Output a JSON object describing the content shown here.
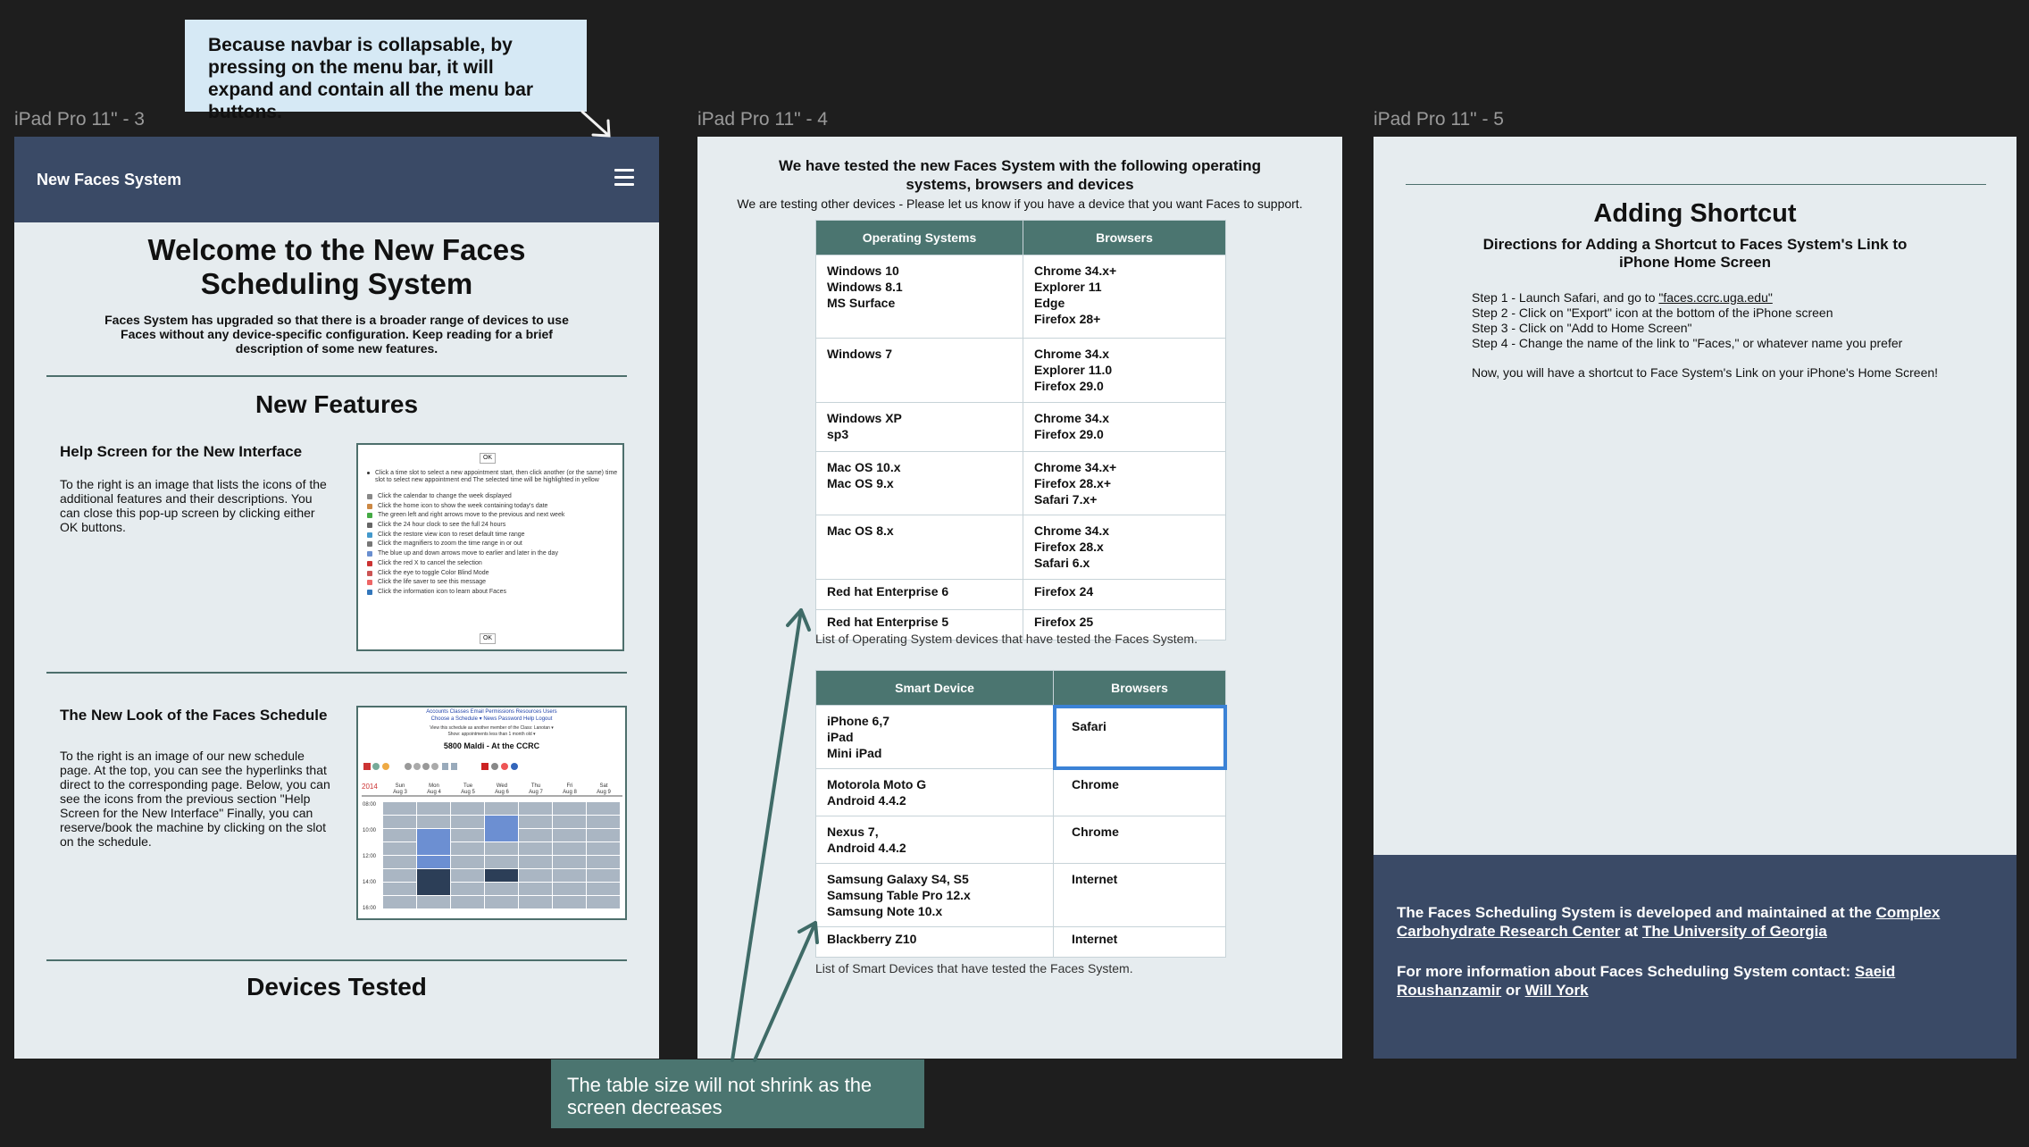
{
  "frames": {
    "f3": {
      "label": "iPad Pro 11\" - 3"
    },
    "f4": {
      "label": "iPad Pro 11\" - 4"
    },
    "f5": {
      "label": "iPad Pro 11\" - 5"
    }
  },
  "annotations": {
    "navbar_note": "Because navbar is collapsable, by pressing on the menu bar, it will expand and contain all the menu bar buttons.",
    "table_note": "The table size will not shrink as the screen decreases"
  },
  "page3": {
    "brand": "New Faces System",
    "welcome_title": "Welcome to the New Faces Scheduling System",
    "intro": "Faces System has upgraded so that there is a broader range of devices to use Faces without any device-specific configuration. Keep reading for a brief description of some new features.",
    "new_features": "New Features",
    "help_title": "Help Screen for the New Interface",
    "help_text": "To the right is an image that lists the icons of the additional features and their descriptions. You can close this pop-up screen by clicking either OK buttons.",
    "help_img": {
      "ok": "OK",
      "lines": [
        "Click a time slot to select a new appointment start, then click another (or the same) time slot to select new appointment end The selected time will be highlighted in yellow",
        "Click the calendar to change the week displayed",
        "Click the home icon to show the week containing today's date",
        "The green left and right arrows move to the previous and next week",
        "Click the 24 hour clock to see the full 24 hours",
        "Click the restore view icon to reset default time range",
        "Click the magnifiers to zoom the time range in or out",
        "The blue up and down arrows move to earlier and later in the day",
        "Click the red X to cancel the selection",
        "Click the eye to toggle Color Blind Mode",
        "Click the life saver to see this message",
        "Click the information icon to learn about Faces"
      ]
    },
    "look_title": "The New Look of the Faces Schedule",
    "look_text": "To the right is an image of our new schedule page. At the top, you can see the hyperlinks that direct to the corresponding page. Below, you can see the icons from the previous section \"Help Screen for the New Interface\" Finally, you can reserve/book the machine by clicking on the slot on the schedule.",
    "sched_img": {
      "links": "Accounts  Classes  Email  Permissions  Resources  Users",
      "links2": "Choose a Schedule ▾   News   Password Help   Logout",
      "view_for": "View this schedule as another member of the Class: Lanotan ▾",
      "show": "Show: appointments less than 1 month old ▾",
      "machine": "5800 Maldi - At the CCRC",
      "year": "2014",
      "days": [
        "Sun",
        "Mon",
        "Tue",
        "Wed",
        "Thu",
        "Fri",
        "Sat"
      ],
      "dates": [
        "Aug 3",
        "Aug 4",
        "Aug 5",
        "Aug 6",
        "Aug 7",
        "Aug 8",
        "Aug 9"
      ],
      "times": [
        "08:00",
        "10:00",
        "12:00",
        "14:00",
        "16:00"
      ]
    },
    "devices_tested": "Devices Tested"
  },
  "page4": {
    "title": "We have tested the new Faces System with the following operating systems, browsers and devices",
    "subtitle": "We are testing other devices - Please let us know if you have a device that you want Faces to support.",
    "os_table": {
      "headers": [
        "Operating Systems",
        "Browsers"
      ],
      "rows": [
        {
          "os": [
            "Windows 10",
            "Windows 8.1",
            "MS Surface"
          ],
          "browsers": [
            "Chrome 34.x+",
            "Explorer 11",
            "Edge",
            "Firefox 28+"
          ]
        },
        {
          "os": [
            "Windows 7"
          ],
          "browsers": [
            "Chrome 34.x",
            "Explorer 11.0",
            "Firefox 29.0"
          ]
        },
        {
          "os": [
            "Windows XP",
            "sp3"
          ],
          "browsers": [
            "Chrome 34.x",
            "Firefox 29.0"
          ]
        },
        {
          "os": [
            "Mac OS 10.x",
            "Mac OS 9.x"
          ],
          "browsers": [
            "Chrome 34.x+",
            "Firefox 28.x+",
            "Safari 7.x+"
          ]
        },
        {
          "os": [
            "Mac OS 8.x"
          ],
          "browsers": [
            "Chrome 34.x",
            "Firefox 28.x",
            "Safari 6.x"
          ]
        },
        {
          "os": [
            "Red hat Enterprise 6"
          ],
          "browsers": [
            "Firefox 24"
          ]
        },
        {
          "os": [
            "Red hat Enterprise 5"
          ],
          "browsers": [
            "Firefox 25"
          ]
        }
      ]
    },
    "os_caption": "List of Operating System devices that have tested the Faces System.",
    "device_table": {
      "headers": [
        "Smart Device",
        "Browsers"
      ],
      "rows": [
        {
          "device": [
            "iPhone 6,7",
            "iPad",
            "Mini iPad"
          ],
          "browsers": [
            "Safari"
          ]
        },
        {
          "device": [
            "Motorola Moto G",
            "Android 4.4.2"
          ],
          "browsers": [
            "Chrome"
          ]
        },
        {
          "device": [
            "Nexus 7,",
            "Android 4.4.2"
          ],
          "browsers": [
            "Chrome"
          ]
        },
        {
          "device": [
            "Samsung Galaxy S4, S5",
            "Samsung Table Pro 12.x",
            "Samsung Note 10.x"
          ],
          "browsers": [
            "Internet"
          ]
        },
        {
          "device": [
            "Blackberry Z10"
          ],
          "browsers": [
            "Internet"
          ]
        }
      ]
    },
    "device_caption": "List of Smart Devices that have tested the Faces System."
  },
  "page5": {
    "title": "Adding Shortcut",
    "subtitle": "Directions for Adding a Shortcut to Faces System's Link to iPhone Home Screen",
    "step1_pre": "Step 1 - Launch Safari, and go to ",
    "step1_link": "\"faces.ccrc.uga.edu\"",
    "step2": "Step 2 - Click on \"Export\" icon at the bottom of the iPhone screen",
    "step3": "Step 3 - Click on \"Add to Home Screen\"",
    "step4": "Step 4 - Change the name of the link to \"Faces,\" or whatever name you prefer",
    "done": "Now, you will have a shortcut to Face System's Link on your iPhone's Home Screen!",
    "footer": {
      "dev_pre": "The Faces Scheduling System is developed and maintained at the ",
      "ccrc": "Complex Carbohydrate Research Center",
      "at": " at ",
      "uga": "The University of Georgia",
      "contact_pre": "For more information about Faces Scheduling System contact: ",
      "saeid": "Saeid Roushanzamir",
      "or": " or ",
      "will": "Will York"
    }
  },
  "colors": {
    "navbar": "#3a4a66",
    "teal": "#4b7570",
    "frame_bg": "#e6ecef",
    "note_blue": "#d6e9f5",
    "selection": "#3b82d6"
  }
}
